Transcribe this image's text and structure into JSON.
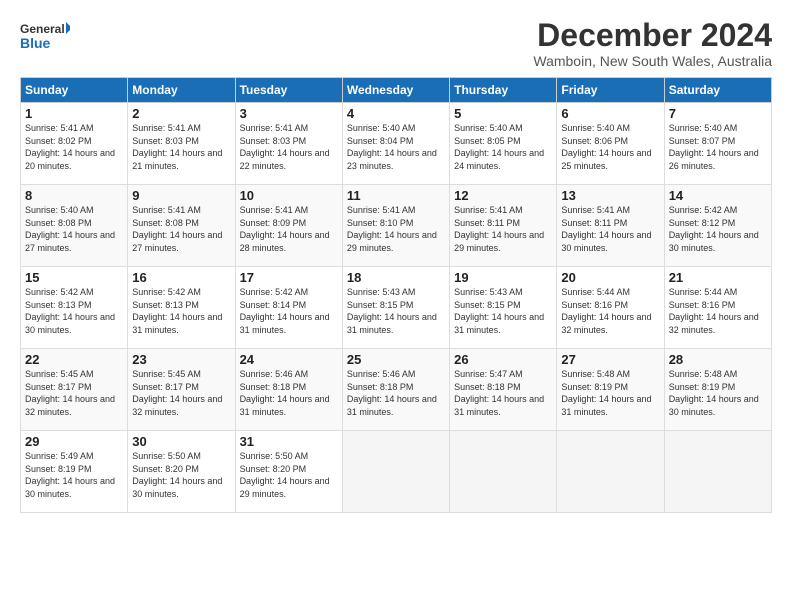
{
  "logo": {
    "line1": "General",
    "line2": "Blue"
  },
  "title": "December 2024",
  "subtitle": "Wamboin, New South Wales, Australia",
  "days_header": [
    "Sunday",
    "Monday",
    "Tuesday",
    "Wednesday",
    "Thursday",
    "Friday",
    "Saturday"
  ],
  "weeks": [
    [
      {
        "num": "1",
        "rise": "5:41 AM",
        "set": "8:02 PM",
        "daylight": "14 hours and 20 minutes."
      },
      {
        "num": "2",
        "rise": "5:41 AM",
        "set": "8:03 PM",
        "daylight": "14 hours and 21 minutes."
      },
      {
        "num": "3",
        "rise": "5:41 AM",
        "set": "8:03 PM",
        "daylight": "14 hours and 22 minutes."
      },
      {
        "num": "4",
        "rise": "5:40 AM",
        "set": "8:04 PM",
        "daylight": "14 hours and 23 minutes."
      },
      {
        "num": "5",
        "rise": "5:40 AM",
        "set": "8:05 PM",
        "daylight": "14 hours and 24 minutes."
      },
      {
        "num": "6",
        "rise": "5:40 AM",
        "set": "8:06 PM",
        "daylight": "14 hours and 25 minutes."
      },
      {
        "num": "7",
        "rise": "5:40 AM",
        "set": "8:07 PM",
        "daylight": "14 hours and 26 minutes."
      }
    ],
    [
      {
        "num": "8",
        "rise": "5:40 AM",
        "set": "8:08 PM",
        "daylight": "14 hours and 27 minutes."
      },
      {
        "num": "9",
        "rise": "5:41 AM",
        "set": "8:08 PM",
        "daylight": "14 hours and 27 minutes."
      },
      {
        "num": "10",
        "rise": "5:41 AM",
        "set": "8:09 PM",
        "daylight": "14 hours and 28 minutes."
      },
      {
        "num": "11",
        "rise": "5:41 AM",
        "set": "8:10 PM",
        "daylight": "14 hours and 29 minutes."
      },
      {
        "num": "12",
        "rise": "5:41 AM",
        "set": "8:11 PM",
        "daylight": "14 hours and 29 minutes."
      },
      {
        "num": "13",
        "rise": "5:41 AM",
        "set": "8:11 PM",
        "daylight": "14 hours and 30 minutes."
      },
      {
        "num": "14",
        "rise": "5:42 AM",
        "set": "8:12 PM",
        "daylight": "14 hours and 30 minutes."
      }
    ],
    [
      {
        "num": "15",
        "rise": "5:42 AM",
        "set": "8:13 PM",
        "daylight": "14 hours and 30 minutes."
      },
      {
        "num": "16",
        "rise": "5:42 AM",
        "set": "8:13 PM",
        "daylight": "14 hours and 31 minutes."
      },
      {
        "num": "17",
        "rise": "5:42 AM",
        "set": "8:14 PM",
        "daylight": "14 hours and 31 minutes."
      },
      {
        "num": "18",
        "rise": "5:43 AM",
        "set": "8:15 PM",
        "daylight": "14 hours and 31 minutes."
      },
      {
        "num": "19",
        "rise": "5:43 AM",
        "set": "8:15 PM",
        "daylight": "14 hours and 31 minutes."
      },
      {
        "num": "20",
        "rise": "5:44 AM",
        "set": "8:16 PM",
        "daylight": "14 hours and 32 minutes."
      },
      {
        "num": "21",
        "rise": "5:44 AM",
        "set": "8:16 PM",
        "daylight": "14 hours and 32 minutes."
      }
    ],
    [
      {
        "num": "22",
        "rise": "5:45 AM",
        "set": "8:17 PM",
        "daylight": "14 hours and 32 minutes."
      },
      {
        "num": "23",
        "rise": "5:45 AM",
        "set": "8:17 PM",
        "daylight": "14 hours and 32 minutes."
      },
      {
        "num": "24",
        "rise": "5:46 AM",
        "set": "8:18 PM",
        "daylight": "14 hours and 31 minutes."
      },
      {
        "num": "25",
        "rise": "5:46 AM",
        "set": "8:18 PM",
        "daylight": "14 hours and 31 minutes."
      },
      {
        "num": "26",
        "rise": "5:47 AM",
        "set": "8:18 PM",
        "daylight": "14 hours and 31 minutes."
      },
      {
        "num": "27",
        "rise": "5:48 AM",
        "set": "8:19 PM",
        "daylight": "14 hours and 31 minutes."
      },
      {
        "num": "28",
        "rise": "5:48 AM",
        "set": "8:19 PM",
        "daylight": "14 hours and 30 minutes."
      }
    ],
    [
      {
        "num": "29",
        "rise": "5:49 AM",
        "set": "8:19 PM",
        "daylight": "14 hours and 30 minutes."
      },
      {
        "num": "30",
        "rise": "5:50 AM",
        "set": "8:20 PM",
        "daylight": "14 hours and 30 minutes."
      },
      {
        "num": "31",
        "rise": "5:50 AM",
        "set": "8:20 PM",
        "daylight": "14 hours and 29 minutes."
      },
      null,
      null,
      null,
      null
    ]
  ]
}
